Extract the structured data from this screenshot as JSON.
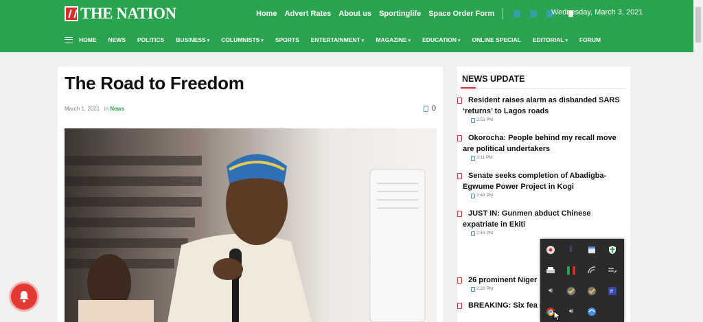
{
  "header": {
    "logo_text": "THE NATION",
    "top_links": [
      "Home",
      "Advert Rates",
      "About us",
      "Sportinglife",
      "Space Order Form"
    ],
    "date": "Wednesday, March 3, 2021",
    "nav": [
      {
        "label": "HOME",
        "dropdown": false
      },
      {
        "label": "NEWS",
        "dropdown": false
      },
      {
        "label": "POLITICS",
        "dropdown": false
      },
      {
        "label": "BUSINESS",
        "dropdown": true
      },
      {
        "label": "COLUMNISTS",
        "dropdown": true
      },
      {
        "label": "SPORTS",
        "dropdown": false
      },
      {
        "label": "ENTERTAINMENT",
        "dropdown": true
      },
      {
        "label": "MAGAZINE",
        "dropdown": true
      },
      {
        "label": "EDUCATION",
        "dropdown": true
      },
      {
        "label": "ONLINE SPECIAL",
        "dropdown": false
      },
      {
        "label": "EDITORIAL",
        "dropdown": true
      },
      {
        "label": "FORUM",
        "dropdown": false
      }
    ]
  },
  "article": {
    "title": "The Road to Freedom",
    "date": "March 1, 2021",
    "in_label": "in",
    "category": "News",
    "comment_count": "0"
  },
  "sidebar": {
    "heading": "NEWS UPDATE",
    "items": [
      {
        "title": "Resident raises alarm as disbanded SARS ‘returns’ to Lagos roads",
        "time": "3:53 PM"
      },
      {
        "title": "Okorocha: People behind my recall move are political undertakers",
        "time": "3:11 PM"
      },
      {
        "title": "Senate seeks completion of Abadigba-Egwume Power Project in Kogi",
        "time": "2:48 PM"
      },
      {
        "title": "JUST IN: Gunmen abduct Chinese expatriate in Ekiti",
        "time": "2:43 PM"
      },
      {
        "title": "26 prominent Niger",
        "time": "2:20 PM"
      },
      {
        "title": "BREAKING: Six fea night attack on Poli",
        "time": ""
      }
    ]
  },
  "colors": {
    "header_green": "#2aa34f",
    "accent_red": "#d32f2f",
    "icon_blue": "#3a9dbd",
    "tray_bg": "#2b2b2b"
  },
  "tray_icons": [
    "chrome-badge-icon",
    "bluetooth-icon",
    "window-icon",
    "shield-icon",
    "printer-icon",
    "flag-icon",
    "wifi-icon",
    "pen-icon",
    "speaker-icon",
    "check-icon",
    "check-icon",
    "app-icon",
    "chrome-icon",
    "speaker-icon",
    "globe-icon"
  ]
}
